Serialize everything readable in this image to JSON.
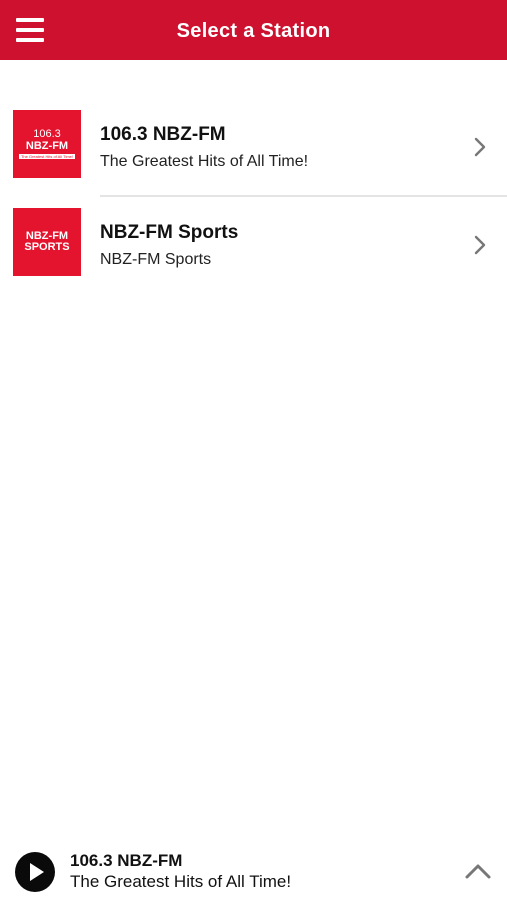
{
  "header": {
    "title": "Select a Station",
    "bg_color": "#cf1130",
    "menu_icon": "hamburger-menu-icon"
  },
  "stations": [
    {
      "name": "106.3 NBZ-FM",
      "description": "The Greatest Hits of All Time!",
      "logo": {
        "line1": "106.3",
        "line2": "NBZ-FM",
        "line3": "The Greatest Hits of All Time!"
      }
    },
    {
      "name": "NBZ-FM Sports",
      "description": "NBZ-FM Sports",
      "logo": {
        "line1": "NBZ-FM",
        "line2": "SPORTS"
      }
    }
  ],
  "player": {
    "station_name": "106.3 NBZ-FM",
    "station_description": "The Greatest Hits of All Time!",
    "play_icon": "play-icon",
    "expand_icon": "chevron-up-icon"
  },
  "colors": {
    "accent": "#cf1130",
    "logo_bg": "#e4132e",
    "chevron": "#777777"
  }
}
